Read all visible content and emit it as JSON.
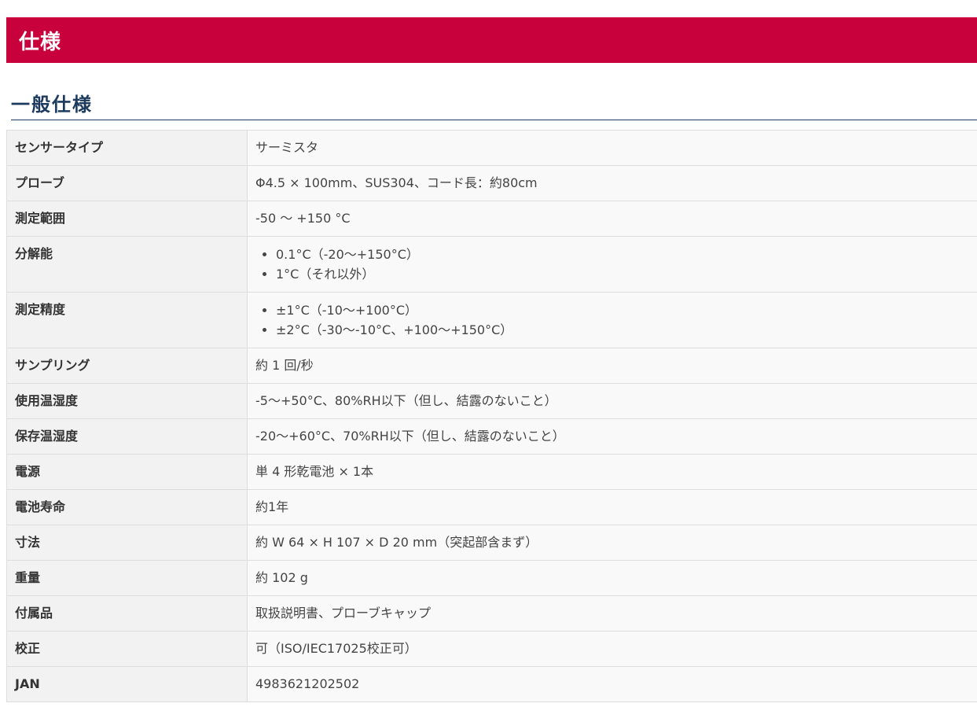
{
  "page": {
    "header_title": "仕様",
    "section_title": "一般仕様"
  },
  "specs": {
    "sensor_type": {
      "label": "センサータイプ",
      "value": "サーミスタ"
    },
    "probe": {
      "label": "プローブ",
      "value": "Φ4.5 × 100mm、SUS304、コード長：約80cm"
    },
    "range": {
      "label": "測定範囲",
      "value": "-50 ～ +150 °C"
    },
    "resolution": {
      "label": "分解能",
      "items": [
        "0.1°C（-20～+150°C）",
        "1°C（それ以外）"
      ]
    },
    "accuracy": {
      "label": "測定精度",
      "items": [
        "±1°C（-10～+100°C）",
        "±2°C（-30～-10°C、+100～+150°C）"
      ]
    },
    "sampling": {
      "label": "サンプリング",
      "value": "約 1 回/秒"
    },
    "operating_env": {
      "label": "使用温湿度",
      "value": "-5～+50°C、80%RH以下（但し、結露のないこと）"
    },
    "storage_env": {
      "label": "保存温湿度",
      "value": "-20～+60°C、70%RH以下（但し、結露のないこと）"
    },
    "power": {
      "label": "電源",
      "value": "単 4 形乾電池 × 1本"
    },
    "battery_life": {
      "label": "電池寿命",
      "value": "約1年"
    },
    "dimensions": {
      "label": "寸法",
      "value": "約 W 64 × H 107 × D 20 mm（突起部含まず）"
    },
    "weight": {
      "label": "重量",
      "value": "約 102 g"
    },
    "accessories": {
      "label": "付属品",
      "value": "取扱説明書、プローブキャップ"
    },
    "calibration": {
      "label": "校正",
      "value": "可（ISO/IEC17025校正可）"
    },
    "jan": {
      "label": "JAN",
      "value": "4983621202502"
    }
  },
  "colors": {
    "header_bg": "#c8003c",
    "section_title": "#1c3a5e"
  }
}
